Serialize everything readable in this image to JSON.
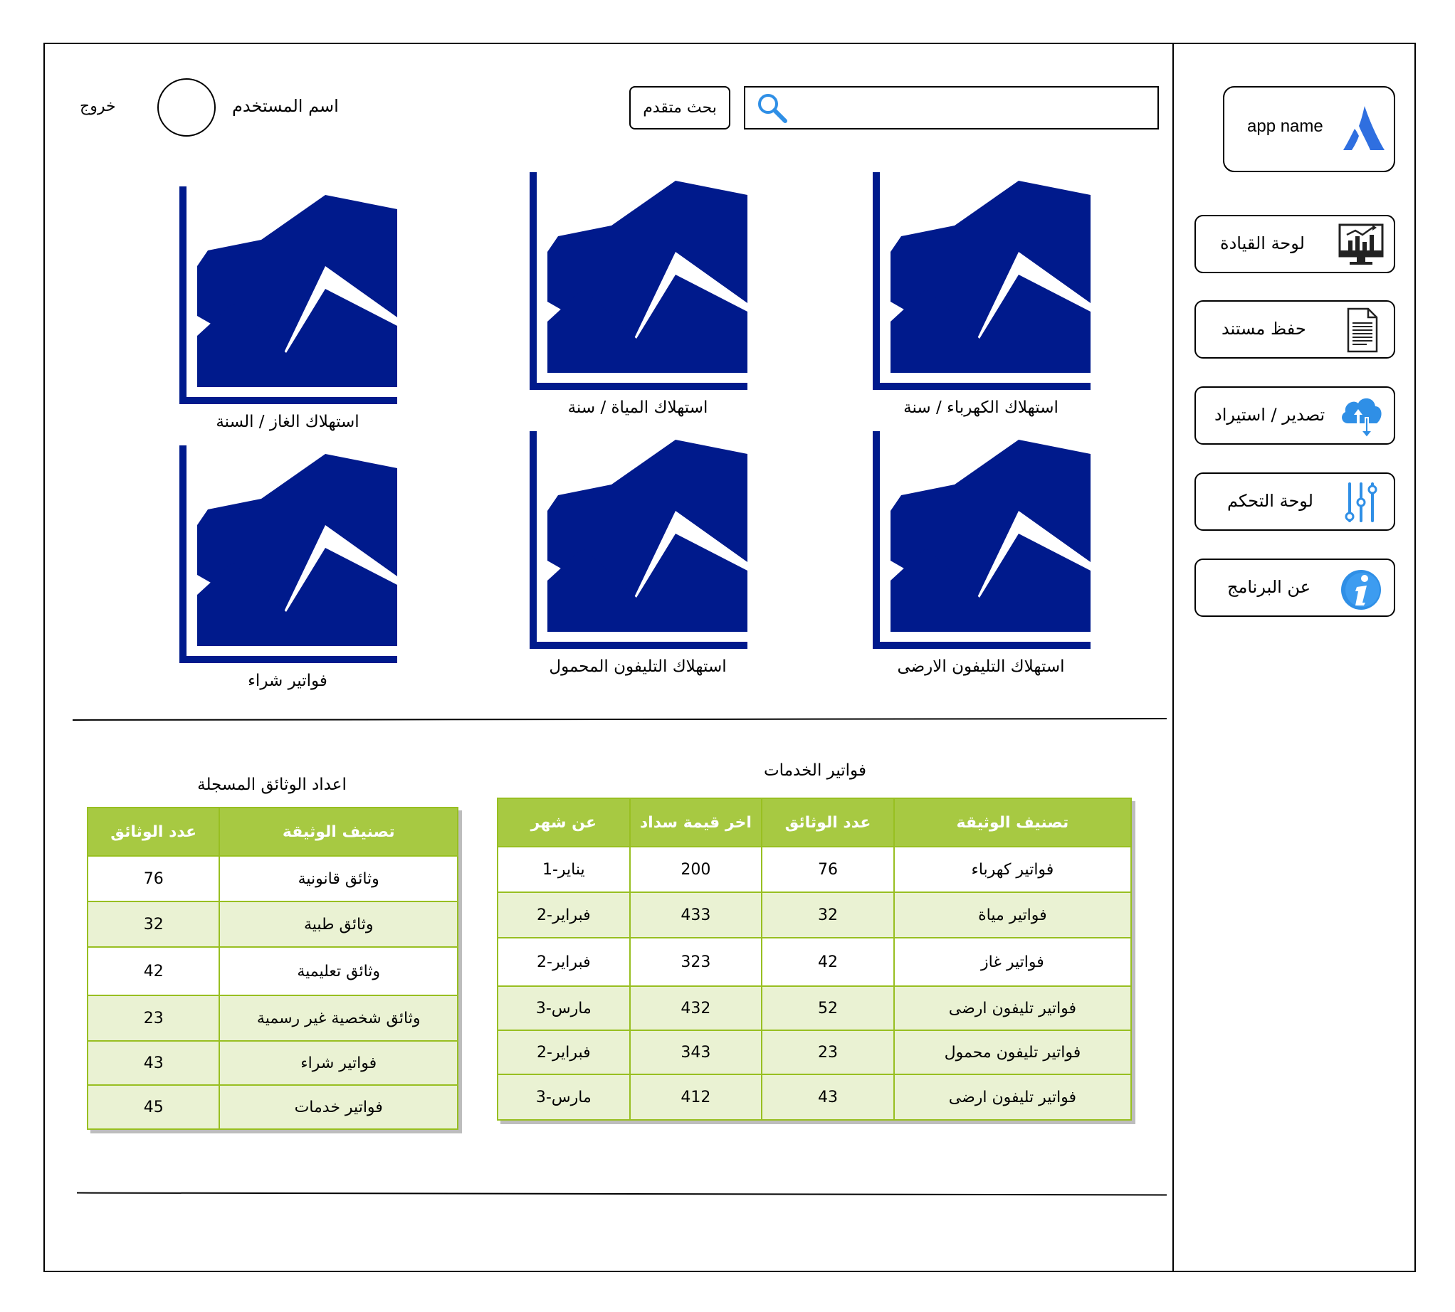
{
  "sidebar": {
    "app_name": "app name",
    "items": [
      {
        "label": "لوحة القيادة",
        "icon": "dashboard-monitor-icon"
      },
      {
        "label": "حفظ مستند",
        "icon": "document-icon"
      },
      {
        "label": "تصدير / استيراد",
        "icon": "cloud-upload-download-icon"
      },
      {
        "label": "لوحة التحكم",
        "icon": "sliders-icon"
      },
      {
        "label": "عن البرنامج",
        "icon": "info-icon"
      }
    ]
  },
  "header": {
    "search_value": "",
    "advanced_search_label": "بحث متقدم",
    "username": "اسم المستخدم",
    "logout_label": "خروج"
  },
  "charts": [
    {
      "label": "استهلاك الكهرباء / سنة"
    },
    {
      "label": "استهلاك المياة / سنة"
    },
    {
      "label": "استهلاك الغاز / السنة"
    },
    {
      "label": "استهلاك التليفون الارضى"
    },
    {
      "label": "استهلاك التليفون المحمول"
    },
    {
      "label": "فواتير شراء"
    }
  ],
  "services_table": {
    "title": "فواتير الخدمات",
    "headers": [
      "تصنيف الوثيقة",
      "عدد الوثائق",
      "اخر قيمة سداد",
      "عن شهر"
    ],
    "rows": [
      [
        "فواتير كهرباء",
        "76",
        "200",
        "يناير-1"
      ],
      [
        "فواتير مياة",
        "32",
        "433",
        "فبراير-2"
      ],
      [
        "فواتير غاز",
        "42",
        "323",
        "فبراير-2"
      ],
      [
        "فواتير تليفون ارضى",
        "52",
        "432",
        "مارس-3"
      ],
      [
        "فواتير تليفون محمول",
        "23",
        "343",
        "فبراير-2"
      ],
      [
        "فواتير تليفون ارضى",
        "43",
        "412",
        "مارس-3"
      ]
    ]
  },
  "documents_table": {
    "title": "اعداد الوثائق المسجلة",
    "headers": [
      "تصنيف الوثيقة",
      "عدد الوثائق"
    ],
    "rows": [
      [
        "وثائق قانونية",
        "76"
      ],
      [
        "وثائق طبية",
        "32"
      ],
      [
        "وثائق تعليمية",
        "42"
      ],
      [
        "وثائق شخصية غير رسمية",
        "23"
      ],
      [
        "فواتير شراء",
        "43"
      ],
      [
        "فواتير خدمات",
        "45"
      ]
    ]
  },
  "colors": {
    "chart_fill": "#001a8c",
    "table_header": "#a7c942",
    "table_border": "#98bf21",
    "table_alt_row": "#eaf2d3",
    "icon_blue": "#2f8fe6"
  }
}
